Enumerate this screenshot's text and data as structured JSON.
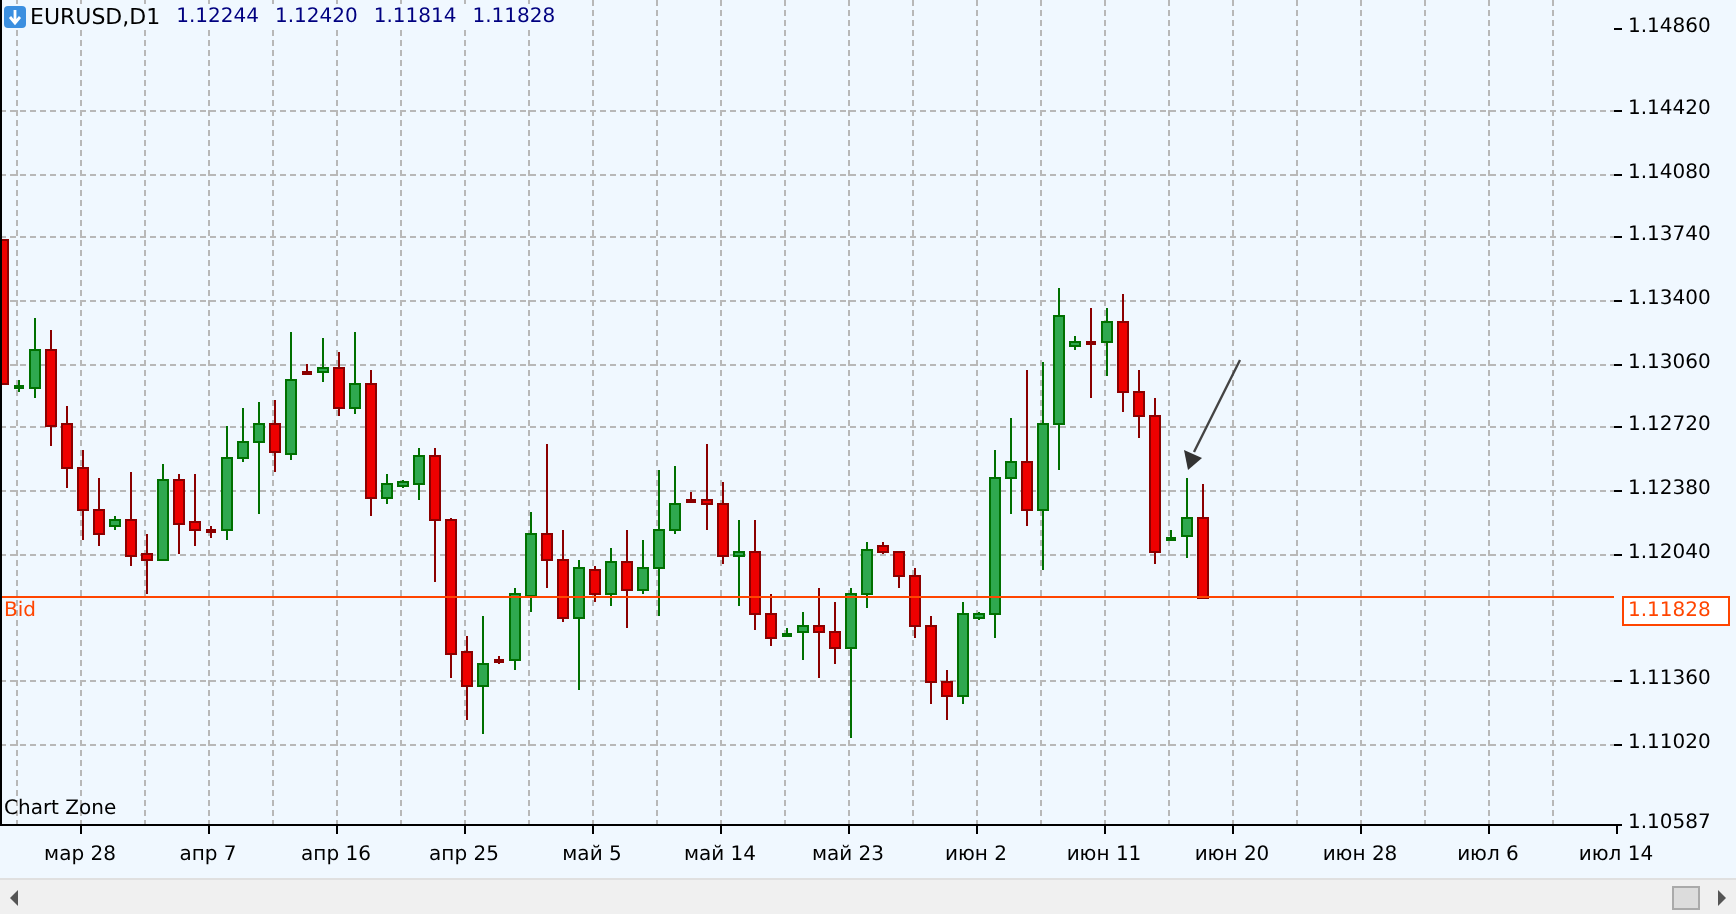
{
  "chart": {
    "symbol": "EURUSD,D1",
    "ohlc": [
      "1.12244",
      "1.12420",
      "1.11814",
      "1.11828"
    ],
    "price_labels": [
      "1.14860",
      "1.14420",
      "1.14080",
      "1.13740",
      "1.13400",
      "1.13060",
      "1.12720",
      "1.12380",
      "1.12040",
      "1.11360",
      "1.11020",
      "1.10587"
    ],
    "bid": {
      "label": "Bid",
      "price": "1.11828"
    },
    "date_labels": [
      "мар 28",
      "апр 7",
      "апр 16",
      "апр 25",
      "май 5",
      "май 14",
      "май 23",
      "июн 2",
      "июн 11",
      "июн 20",
      "июн 28",
      "июл 6",
      "июл 14"
    ],
    "zone_label": "Chart Zone"
  }
}
